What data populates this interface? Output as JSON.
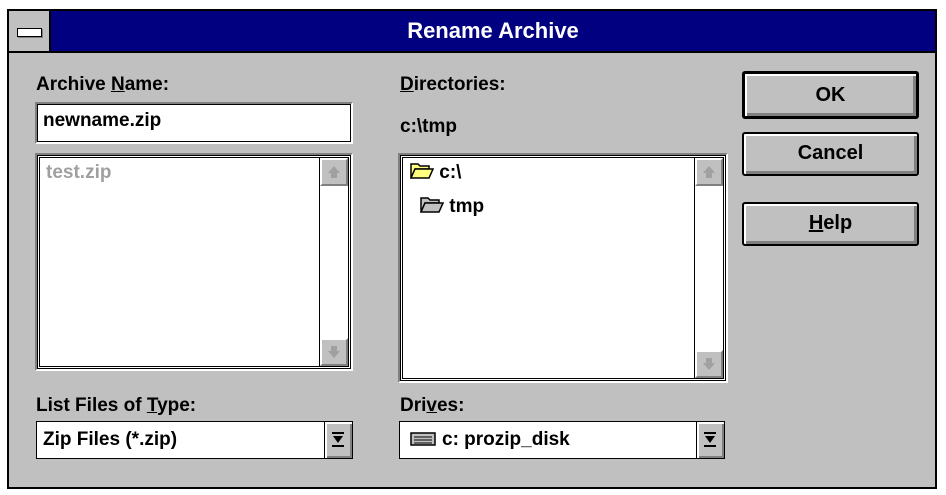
{
  "window": {
    "title": "Rename Archive"
  },
  "archive_name": {
    "label_pre": "Archive ",
    "label_mnemonic": "N",
    "label_post": "ame:",
    "value": "newname.zip"
  },
  "file_list": {
    "items": [
      "test.zip"
    ]
  },
  "file_type": {
    "label_pre": "List Files of ",
    "label_mnemonic": "T",
    "label_post": "ype:",
    "selected": "Zip Files (*.zip)"
  },
  "directories": {
    "label_pre": "",
    "label_mnemonic": "D",
    "label_post": "irectories:",
    "current_path": "c:\\tmp",
    "items": [
      {
        "name": "c:\\",
        "icon": "open-folder-icon"
      },
      {
        "name": "tmp",
        "icon": "open-folder-icon"
      }
    ]
  },
  "drives": {
    "label_pre": "Dri",
    "label_mnemonic": "v",
    "label_post": "es:",
    "selected": "c: prozip_disk",
    "icon": "hard-drive-icon"
  },
  "buttons": {
    "ok": "OK",
    "cancel": "Cancel",
    "help_mnemonic": "H",
    "help_post": "elp"
  },
  "colors": {
    "title_bar": "#000080",
    "face": "#c0c0c0",
    "folder": "#ffff80"
  }
}
